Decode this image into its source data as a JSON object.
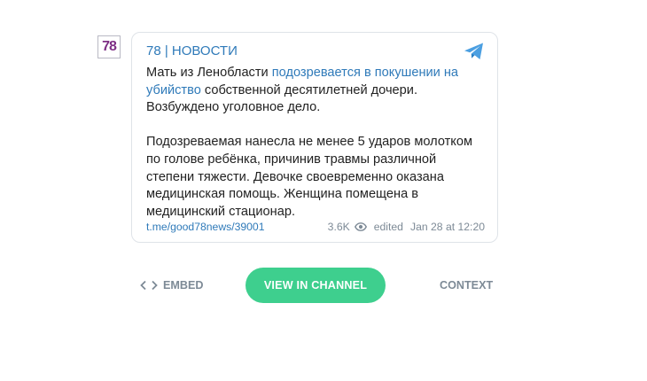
{
  "post": {
    "avatar_text": "78",
    "channel": "78 | НОВОСТИ",
    "p1_a": "Мать из Ленобласти ",
    "p1_link": "подозревается в покушении на убийство",
    "p1_b": " собственной десятилетней дочери. Возбуждено уголовное дело.",
    "p2": "Подозреваемая нанесла не менее 5 ударов молотком по голове ребёнка, причинив травмы различной степени тяжести. Девочке своевременно оказана медицинская помощь. Женщина помещена в медицинский стационар.",
    "link": "t.me/good78news/39001",
    "views": "3.6K",
    "edited": "edited",
    "date": "Jan 28 at 12:20"
  },
  "actions": {
    "embed": "EMBED",
    "view_in_channel": "VIEW IN CHANNEL",
    "context": "CONTEXT"
  },
  "icons": {
    "telegram": "telegram-plane-icon",
    "eye": "eye-icon",
    "code": "code-brackets-icon"
  },
  "colors": {
    "link": "#2f7ab9",
    "button": "#3ecf8e",
    "muted": "#7d8a96",
    "avatar": "#7d2e84"
  }
}
